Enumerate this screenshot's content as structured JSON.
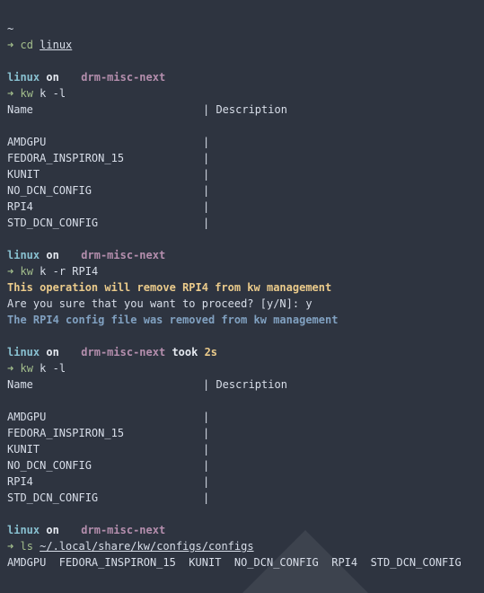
{
  "prompt": {
    "home": "~",
    "arrow": "➜",
    "on": "on",
    "took": "took",
    "dir": "linux",
    "branch_icon": "",
    "branch": "drm-misc-next"
  },
  "blocks": [
    {
      "cmd": "cd",
      "arg": "linux"
    },
    {
      "cmd": "kw",
      "arg": "k -l"
    },
    {
      "cmd": "kw",
      "arg": "k -r RPI4"
    },
    {
      "cmd": "kw",
      "arg": "k -l",
      "duration": "2s"
    },
    {
      "cmd": "ls",
      "arg": "~/.local/share/kw/configs/configs"
    }
  ],
  "table": {
    "header_name": "Name",
    "header_desc": "| Description",
    "separator": "|",
    "rows_first": [
      "AMDGPU",
      "FEDORA_INSPIRON_15",
      "KUNIT",
      "NO_DCN_CONFIG",
      "RPI4",
      "STD_DCN_CONFIG"
    ],
    "rows_second": [
      "AMDGPU",
      "FEDORA_INSPIRON_15",
      "KUNIT",
      "NO_DCN_CONFIG",
      "RPI4",
      "STD_DCN_CONFIG"
    ]
  },
  "messages": {
    "warning": "This operation will remove RPI4 from kw management",
    "question": "Are you sure that you want to proceed? [y/N]: y",
    "removed": "The RPI4 config file was removed from kw management"
  },
  "ls_output": "AMDGPU  FEDORA_INSPIRON_15  KUNIT  NO_DCN_CONFIG  RPI4  STD_DCN_CONFIG",
  "colors": {
    "background": "#2e3440",
    "directory": "#88c0d0",
    "branch": "#b48ead",
    "arrow": "#a3be8c",
    "warning": "#ebcb8b",
    "info": "#81a1c1"
  }
}
